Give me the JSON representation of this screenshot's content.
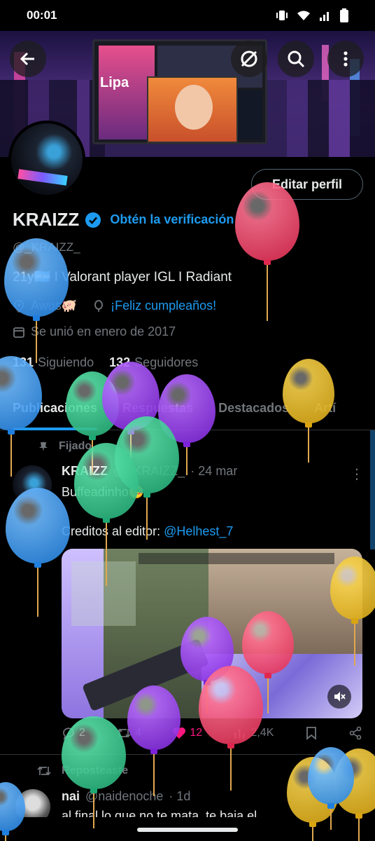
{
  "status_bar": {
    "time": "00:01"
  },
  "header_actions": {
    "back_icon": "arrow-left-icon",
    "mute_icon": "notifications-off-icon",
    "search_icon": "search-icon",
    "more_icon": "more-vertical-icon"
  },
  "banner": {
    "text_left": "Lipa"
  },
  "profile": {
    "edit_button": "Editar perfil",
    "name": "KRAIZZ",
    "verification_link": "Obtén la verificación",
    "handle": "@_KRAIZZ_",
    "bio": "21y🇦🇷 I Valorant player IGL I Radiant",
    "location": "Awus🐖",
    "birthday": "¡Feliz cumpleaños!",
    "joined": "Se unió en enero de 2017",
    "following_count": "131",
    "following_label": "Siguiendo",
    "followers_count": "132",
    "followers_label": "Seguidores"
  },
  "tabs": [
    "Publicaciones",
    "Respuestas",
    "Destacados",
    "Artí"
  ],
  "pinned_post": {
    "pinned_label": "Fijado",
    "author_name": "KRAIZZ",
    "author_handle": "@_KRAIZZ_",
    "date": "· 24 mar",
    "text_line1": "Buffeadinho🤒",
    "text_line2_prefix": "Creditos al editor: ",
    "mention": "@Helhest_7",
    "replies": "2",
    "reposts": "4",
    "likes": "12",
    "views": "2,4K"
  },
  "repost": {
    "repost_label": "Reposteaste",
    "author_name": "nai",
    "author_handle": "@naidenoche",
    "date": "· 1d",
    "text": "al final lo que no te mata, te baja el"
  },
  "colors": {
    "accent": "#1d9bf0",
    "like": "#f91880",
    "muted": "#71767b"
  }
}
